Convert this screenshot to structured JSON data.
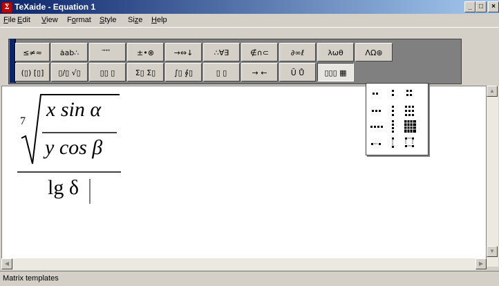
{
  "window": {
    "title": "TeXaide - Equation 1",
    "buttons": {
      "minimize": "_",
      "maximize": "□",
      "close": "×"
    }
  },
  "menu": [
    {
      "label": "File",
      "accel": "F"
    },
    {
      "label": "Edit",
      "accel": "E"
    },
    {
      "label": "View",
      "accel": "V"
    },
    {
      "label": "Format",
      "accel": "o"
    },
    {
      "label": "Style",
      "accel": "S"
    },
    {
      "label": "Size",
      "accel": "z"
    },
    {
      "label": "Help",
      "accel": "H"
    }
  ],
  "toolbar": {
    "row1": [
      "≤≠≈",
      "ȧab∴",
      "⃗ ⃗ ⃗",
      "±•⊗",
      "→⇔↓",
      "∴∀∃",
      "∉∩⊂",
      "∂∞ℓ",
      "λωθ",
      "ΛΩ⊛"
    ],
    "row2": [
      "(▯) [▯]",
      "▯/▯ √▯",
      "▯▯ ▯",
      "Σ▯ Σ▯",
      "∫▯ ∮▯",
      "▯ ▯",
      "→ ←",
      "Ū Ů",
      "▯▯▯ ▦"
    ]
  },
  "equation": {
    "root_index": "7",
    "numerator": "x sin α",
    "denominator": "y cos β",
    "bottom": "lg δ"
  },
  "status": {
    "text": "Matrix templates"
  },
  "colors": {
    "titlebar_start": "#0a246a",
    "titlebar_end": "#a6caf0",
    "face": "#d4d0c8"
  }
}
